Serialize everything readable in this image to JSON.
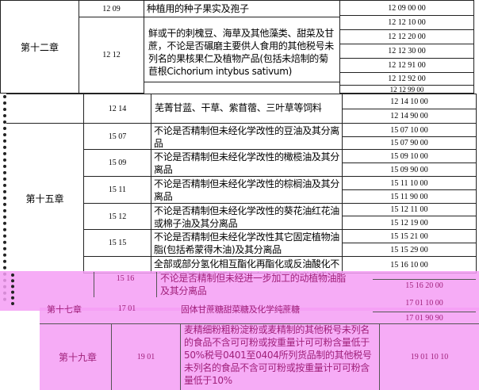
{
  "chapter12": {
    "label": "第十二章",
    "rows": [
      {
        "heading": "12 09",
        "desc": "种植用的种子果实及孢子",
        "codes": [
          "12 09 00 00"
        ]
      },
      {
        "heading": "12 12",
        "desc": "鲜或干的刺槐豆、海草及其他藻类、甜菜及甘蔗，不论是否碾磨主要供人食用的其他税号未列名的果核果仁及植物产品(包括未焙制的菊苣根Cichorium intybus sativum)",
        "codes": [
          "12 12 10 00",
          "12 12 20 00",
          "12 12 30 00",
          "12 12 91 00",
          "12 12 92 00",
          "12 12 99 00"
        ]
      }
    ]
  },
  "chapter_partial": {
    "rows": [
      {
        "heading": "12 14",
        "desc": "芜菁甘蓝、干草、紫苜蓿、三叶草等饲料",
        "codes": [
          "12 14 10 00",
          "12 14 90 00"
        ]
      }
    ]
  },
  "chapter15": {
    "label": "第十五章",
    "rows": [
      {
        "heading": "15 07",
        "desc": "不论是否精制但未经化学改性的豆油及其分离品",
        "codes": [
          "15 07 10 00",
          "15 07 90 00"
        ]
      },
      {
        "heading": "15 09",
        "desc": "不论是否精制但未经化学改性的橄榄油及其分离品",
        "codes": [
          "15 09 10 00",
          "15 09 90 00"
        ]
      },
      {
        "heading": "15 11",
        "desc": "不论是否精制但未经化学改性的棕榈油及其分离品",
        "codes": [
          "15 11 10 00",
          "15 11 90 00"
        ]
      },
      {
        "heading": "15 12",
        "desc": "不论是否精制但未经化学改性的葵花油红花油或棉子油及其分离品",
        "codes": [
          "15 12 11 00",
          "15 12 19 00"
        ]
      },
      {
        "heading": "15 15",
        "desc": "不论是否精制但未经化学改性其它固定植物油脂(包括希蒙得木油)及其分离品",
        "codes": [
          "15 15 21 00",
          "15 15 29 00"
        ]
      },
      {
        "heading": "",
        "desc": "全部或部分氢化相互酯化再酯化或反油酸化不论是否精制但未经进一步加工的动植物油脂及其分离品",
        "codes": [
          "15 16 10 00",
          "15 16 20 00"
        ]
      }
    ]
  },
  "pink_rows": [
    {
      "heading": "15 16",
      "desc": "不论是否精制但未经进一步加工的动植物油脂及其分离品",
      "code": "15 16 20 00"
    },
    {
      "chapter": "第十七章",
      "heading": "17 01",
      "desc": "固体甘蔗糖甜菜糖及化学纯蔗糖",
      "code": "17 01 10 00",
      "code2": "17 01 90 90"
    },
    {
      "chapter": "第十九章",
      "heading": "19 01",
      "desc": "麦精细粉粗粉淀粉或麦精制的其他税号未列名的食品不含可可粉或按重量计可可粉含量低于50%税号0401至0404所列货品制的其他税号未列名的食品不含可可粉或按重量计可可粉含量低于10%",
      "code": "19 01 10 10"
    }
  ]
}
